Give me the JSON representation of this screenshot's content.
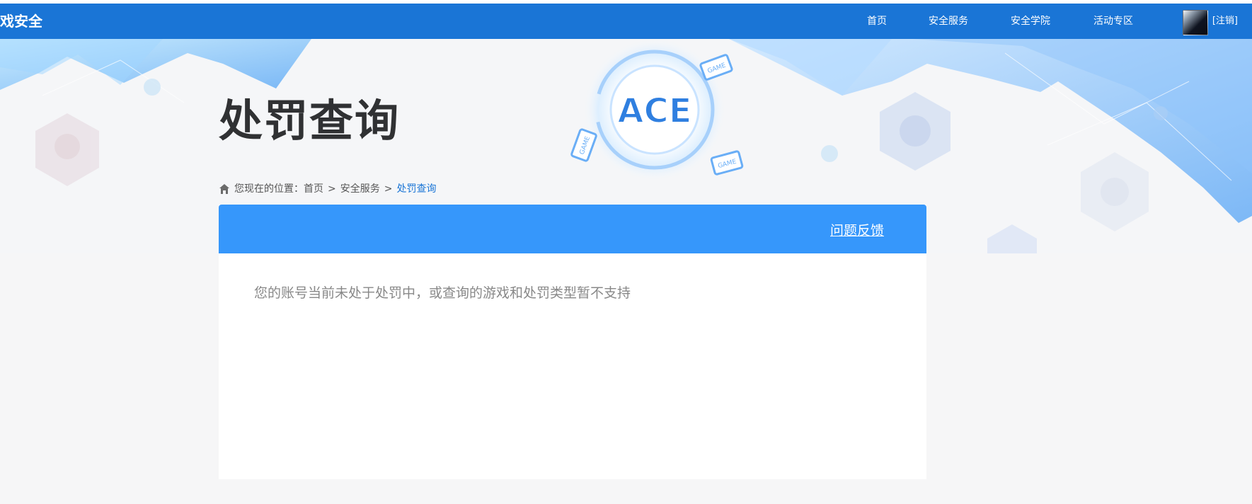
{
  "header": {
    "brand": "戏安全",
    "nav": {
      "home": "首页",
      "service": "安全服务",
      "academy": "安全学院",
      "events": "活动专区"
    },
    "logout": "[注销]"
  },
  "banner": {
    "title": "处罚查询",
    "logo_text": "ACE",
    "game_tags": [
      "GAME",
      "GAME",
      "GAME"
    ]
  },
  "breadcrumb": {
    "prefix": "您现在的位置：",
    "home": "首页",
    "sep1": ">",
    "service": "安全服务",
    "sep2": ">",
    "current": "处罚查询"
  },
  "panel": {
    "feedback": "问题反馈",
    "message": "您的账号当前未处于处罚中，或查询的游戏和处罚类型暂不支持"
  },
  "colors": {
    "header_bg": "#1a75d6",
    "panel_header_bg": "#3697fb",
    "accent": "#1a75d6"
  },
  "icons": {
    "home": "home-icon"
  }
}
